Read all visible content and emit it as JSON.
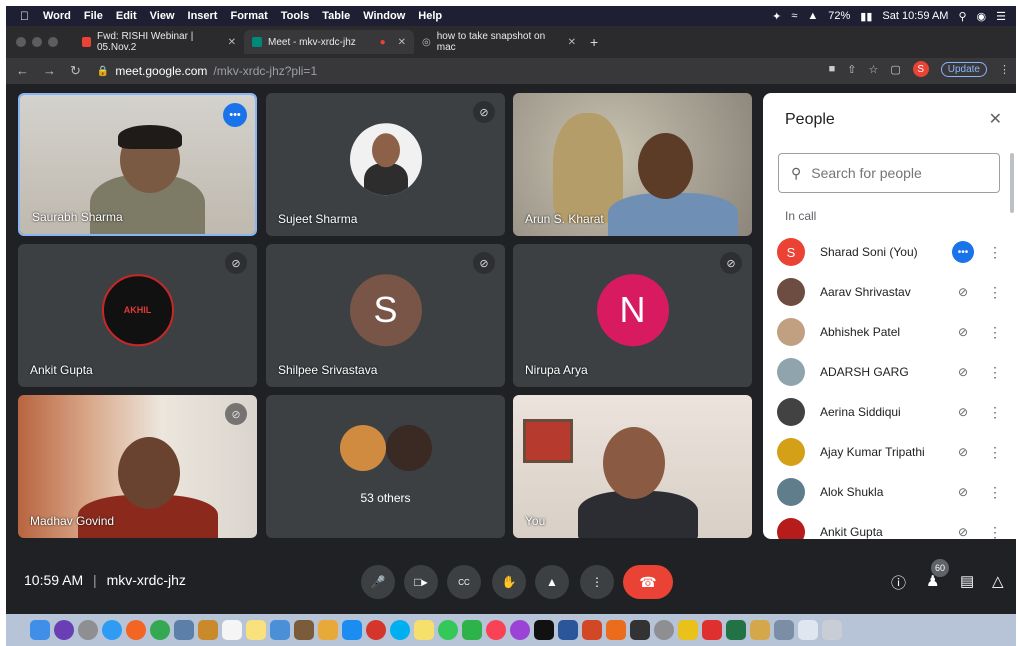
{
  "menubar": {
    "app": "Word",
    "items": [
      "File",
      "Edit",
      "View",
      "Insert",
      "Format",
      "Tools",
      "Table",
      "Window",
      "Help"
    ],
    "battery": "72%",
    "clock": "Sat 10:59 AM"
  },
  "tabs": [
    {
      "label": "Fwd: RISHI Webinar | 05.Nov.2",
      "color": "#ea4335"
    },
    {
      "label": "Meet - mkv-xrdc-jhz",
      "color": "#00897b"
    },
    {
      "label": "how to take snapshot on mac",
      "color": "#9aa0a6"
    }
  ],
  "address": {
    "host": "meet.google.com",
    "path": "/mkv-xrdc-jhz?pli=1",
    "update": "Update",
    "avatar": "S"
  },
  "tiles": [
    {
      "name": "Saurabh Sharma"
    },
    {
      "name": "Sujeet Sharma"
    },
    {
      "name": "Arun S. Kharat"
    },
    {
      "name": "Ankit Gupta"
    },
    {
      "name": "Shilpee Srivastava",
      "initial": "S",
      "color": "#795548"
    },
    {
      "name": "Nirupa Arya",
      "initial": "N",
      "color": "#d81b60"
    },
    {
      "name": "Madhav Govind"
    },
    {
      "name": "53 others"
    },
    {
      "name": "You"
    }
  ],
  "avatar_logo_text": "AKHIL",
  "people": {
    "title": "People",
    "search_placeholder": "Search for people",
    "section": "In call",
    "list": [
      {
        "name": "Sharad Soni (You)",
        "initial": "S",
        "color": "#ea4335"
      },
      {
        "name": "Aarav Shrivastav",
        "color": "#6d4c41"
      },
      {
        "name": "Abhishek Patel",
        "color": "#c0a080"
      },
      {
        "name": "ADARSH GARG",
        "color": "#90a4ae"
      },
      {
        "name": "Aerina Siddiqui",
        "color": "#424242"
      },
      {
        "name": "Ajay Kumar Tripathi",
        "color": "#d4a017"
      },
      {
        "name": "Alok Shukla",
        "color": "#607d8b"
      },
      {
        "name": "Ankit Gupta",
        "color": "#b71c1c"
      }
    ]
  },
  "bottom": {
    "time": "10:59 AM",
    "separator": "|",
    "code": "mkv-xrdc-jhz",
    "participants": "60"
  }
}
